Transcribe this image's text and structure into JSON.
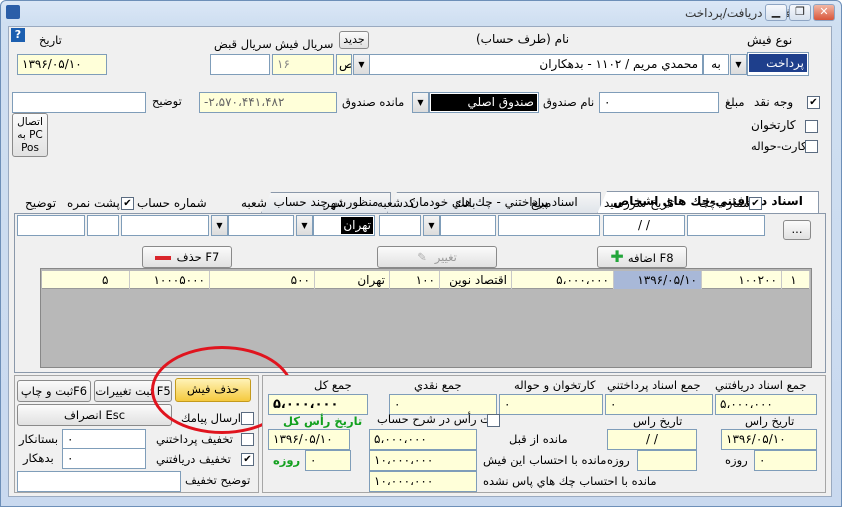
{
  "window": {
    "title": "فيش دريافت/پرداخت",
    "minimize": "▁",
    "restore": "❐",
    "close": "✕"
  },
  "header": {
    "help_icon": "?",
    "date_label": "تاريخ",
    "date_value": "۱۳۹۶/۰۵/۱۰",
    "receipt_serial_label": "سريال قبض",
    "receipt_serial_value": "",
    "slip_serial_label": "سريال فيش",
    "slip_serial_value": "۱۶",
    "new_button": "جديد",
    "account_label": "نام (طرف حساب)",
    "account_value": "محمدي مريم / ۱۱۰۲ - بدهكاران",
    "account_prefix": "به",
    "type_label": "نوع فيش",
    "type_value": "پرداخت",
    "series_char": "ص"
  },
  "cash": {
    "description_label": "توضيح",
    "description_value": "",
    "balance_label": "مانده صندوق",
    "balance_value": "-۲،۵۷۰،۴۴۱،۴۸۲",
    "box_name_label": "نام صندوق",
    "box_name_value": "صندوق اصلي",
    "amount_label": "مبلغ",
    "amount_value": "۰",
    "cash_label": "وجه نقد",
    "cash_checked": true,
    "card_label": "كارتخوان",
    "card_checked": false,
    "card_transfer_label": "كارت-حواله",
    "card_transfer_checked": false,
    "pos_button": "اتصال به PC Pos"
  },
  "tabs": [
    {
      "label": "اسناد دريافتني-چك هاي اشخاص",
      "active": true
    },
    {
      "label": "اسناد پرداختني - چك هاي خودمان",
      "active": false
    },
    {
      "label": "منظور در چند حساب",
      "active": false
    }
  ],
  "cheque_form": {
    "cheque_no_label": "شماره چك",
    "due_date_label": "تاريخ سررسيد",
    "amount_label": "مبلغ",
    "bank_label": "بانك",
    "branch_code_label": "كدشعبه",
    "city_label": "شهر",
    "branch_label": "شعبه",
    "account_no_label": "شماره حساب",
    "back_label": "پشت نمره",
    "description_label": "توضيح",
    "due_date_value": "/ /",
    "city_value": "تهران",
    "more_button": "...",
    "add_button": "اضافه F8",
    "edit_button": "تغيير",
    "delete_button": "حذف F7"
  },
  "cheque_table": {
    "rows": [
      {
        "row": "۱",
        "cheque_no": "۱۰۰۲۰۰",
        "due_date": "۱۳۹۶/۰۵/۱۰",
        "amount": "۵،۰۰۰،۰۰۰",
        "bank": "اقتصاد نوين",
        "branch_code": "۱۰۰",
        "city": "تهران",
        "branch": "۵۰۰",
        "account_no": "۱۰۰۰۵۰۰۰",
        "back": "۵"
      }
    ]
  },
  "actions": {
    "save_print": "ثبت و چاپF6",
    "save_changes": "ثبت تغييرات F5",
    "delete_slip": "حذف فيش",
    "cancel": "انصراف Esc",
    "send_sms": "ارسال پيامك",
    "creditor_label": "بستانكار",
    "creditor_value": "۰",
    "debtor_label": "بدهكار",
    "debtor_value": "۰",
    "discount_payable": "تخفيف پرداختني",
    "discount_receivable": "تخفيف دريافتني",
    "discount_desc_label": "توضيح تخفيف"
  },
  "totals": {
    "total_label": "جمع كل",
    "total_value": "۵،۰۰۰،۰۰۰",
    "cash_total_label": "جمع نقدي",
    "cash_total_value": "۰",
    "card_total_label": "كارتخوان و حواله",
    "card_total_value": "۰",
    "payable_total_label": "جمع اسناد پرداختني",
    "payable_total_value": "۰",
    "receivable_total_label": "جمع اسناد دريافتني",
    "receivable_total_value": "۵،۰۰۰،۰۰۰",
    "due_total_label": "تاريخ رأس كل",
    "due_total_date": "۱۳۹۶/۰۵/۱۰",
    "due_total_days": "۰",
    "days_label": "روزه",
    "record_due_label": "ثبت رأس در شرح حساب",
    "prev_balance_label": "مانده از قبل",
    "prev_balance_value": "۵،۰۰۰،۰۰۰",
    "after_slip_label": "مانده با احتساب اين فيش",
    "after_slip_value": "۱۰،۰۰۰،۰۰۰",
    "uncleared_label": "مانده با احتساب چك هاي پاس نشده",
    "uncleared_value": "۱۰،۰۰۰،۰۰۰",
    "payable_due_label": "تاريخ راس",
    "payable_due_value": "/ /",
    "payable_days_value": "",
    "receivable_due_label": "تاريخ راس",
    "receivable_due_value": "۱۳۹۶/۰۵/۱۰",
    "receivable_days_value": "۰"
  }
}
